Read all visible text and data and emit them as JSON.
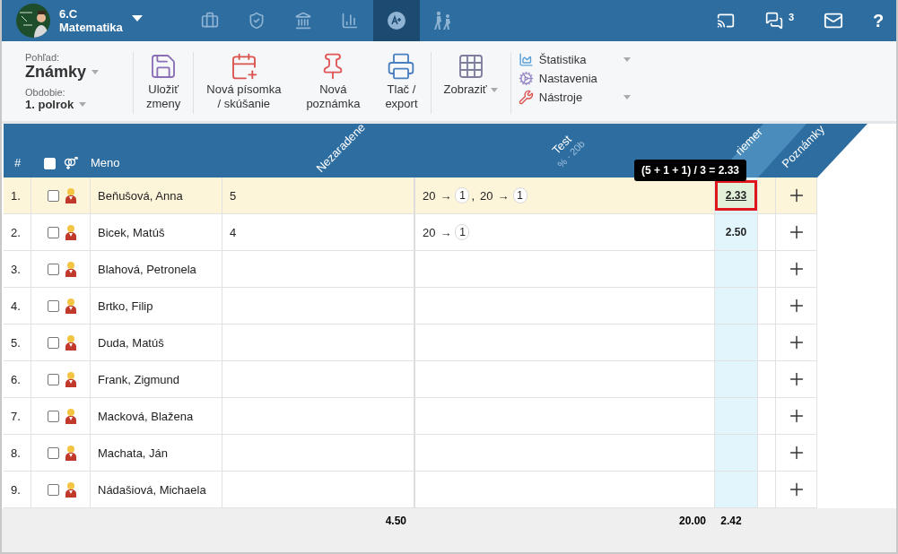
{
  "topbar": {
    "class_name": "6.C",
    "subject": "Matematika",
    "nav": [
      {
        "kind": "briefcase",
        "selected": false
      },
      {
        "kind": "shield",
        "selected": false
      },
      {
        "kind": "bank",
        "selected": false
      },
      {
        "kind": "chart",
        "selected": false
      },
      {
        "kind": "grade",
        "selected": true
      },
      {
        "kind": "walkers",
        "selected": false
      }
    ],
    "messages_count": "3",
    "help": "?"
  },
  "toolbar": {
    "view_label": "Pohľad:",
    "view": "Známky",
    "period_label": "Obdobie:",
    "period": "1. polrok",
    "buttons": [
      {
        "kind": "save",
        "label": "Uložiť\nzmeny",
        "dropdown": false
      },
      {
        "kind": "new_test",
        "label": "Nová písomka\n/ skúšanie",
        "dropdown": false
      },
      {
        "kind": "new_note",
        "label": "Nová\npoznámka",
        "dropdown": false
      },
      {
        "kind": "print",
        "label": "Tlač /\nexport",
        "dropdown": false
      },
      {
        "kind": "display",
        "label": "Zobraziť",
        "dropdown": true
      }
    ],
    "menu": [
      {
        "kind": "stats",
        "label": "Štatistika",
        "dropdown": true
      },
      {
        "kind": "settings",
        "label": "Nastavenia",
        "dropdown": false
      },
      {
        "kind": "tools",
        "label": "Nástroje",
        "dropdown": true
      }
    ]
  },
  "table": {
    "select_all_checked": false,
    "columns": {
      "number": "#",
      "name": "Meno",
      "unassigned": "Nezaradene",
      "test": "Test",
      "test_sub": "% · 20b",
      "average": "riemer",
      "notes": "Poznámky"
    },
    "tooltip": "(5 + 1 + 1) / 3 = 2.33",
    "rows": [
      {
        "number": "1.",
        "name": "Beňušová, Anna",
        "checked": false,
        "selected": true,
        "unassigned": "5",
        "test": [
          {
            "points": "20",
            "arrow": "→",
            "grade": "1",
            "separator": ","
          },
          {
            "points": "20",
            "arrow": "→",
            "grade": "1"
          }
        ],
        "average": "2.33",
        "hovered": true
      },
      {
        "number": "2.",
        "name": "Bicek, Matúš",
        "checked": false,
        "selected": false,
        "unassigned": "4",
        "test": [
          {
            "points": "20",
            "arrow": "→",
            "grade": "1"
          }
        ],
        "average": "2.50",
        "hovered": false
      },
      {
        "number": "3.",
        "name": "Blahová, Petronela",
        "checked": false,
        "selected": false
      },
      {
        "number": "4.",
        "name": "Brtko, Filip",
        "checked": false,
        "selected": false
      },
      {
        "number": "5.",
        "name": "Duda, Matúš",
        "checked": false,
        "selected": false
      },
      {
        "number": "6.",
        "name": "Frank, Zigmund",
        "checked": false,
        "selected": false
      },
      {
        "number": "7.",
        "name": "Macková, Blažena",
        "checked": false,
        "selected": false
      },
      {
        "number": "8.",
        "name": "Machata, Ján",
        "checked": false,
        "selected": false
      },
      {
        "number": "9.",
        "name": "Nádašiová, Michaela",
        "checked": false,
        "selected": false
      }
    ],
    "footer": {
      "unassigned": "4.50",
      "test": "20.00",
      "average": "2.42"
    }
  }
}
